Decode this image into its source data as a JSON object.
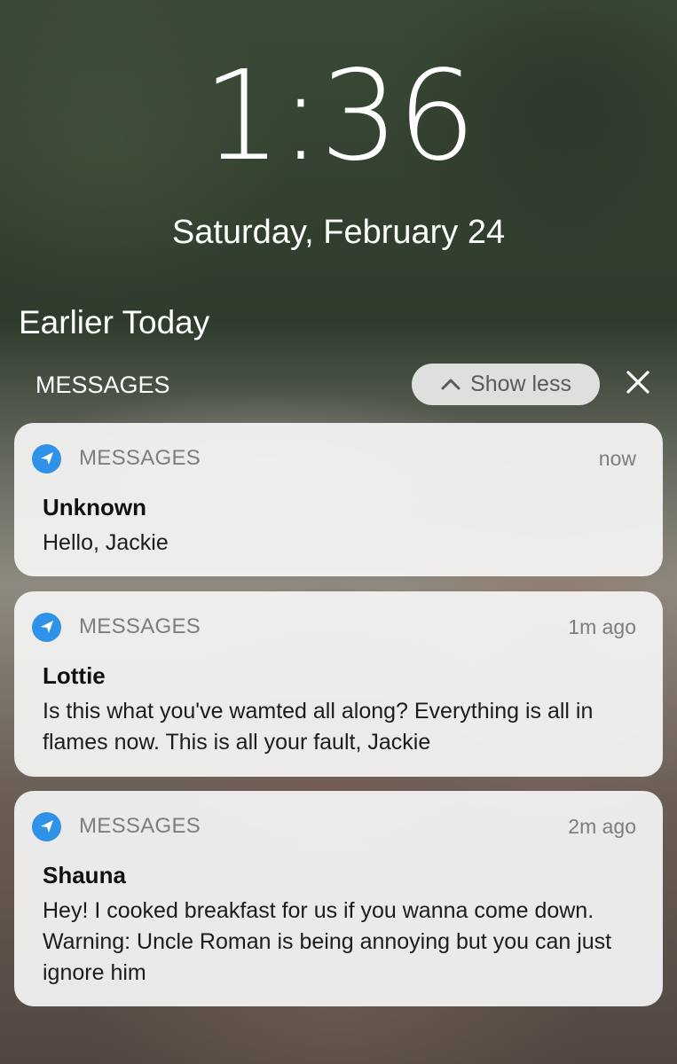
{
  "lockscreen": {
    "time": "1:36",
    "date": "Saturday, February 24"
  },
  "section": {
    "title": "Earlier Today",
    "group_label": "MESSAGES",
    "show_less_label": "Show less"
  },
  "icons": {
    "show_less": "chevron-up-icon",
    "close": "close-icon",
    "app": "send-arrow-icon"
  },
  "colors": {
    "app_icon": "#2f92e8",
    "card_background": "#f5f5f5",
    "text_primary": "#111111",
    "text_secondary": "#7d7d7d"
  },
  "notifications": [
    {
      "app": "MESSAGES",
      "time": "now",
      "sender": "Unknown",
      "message": "Hello, Jackie"
    },
    {
      "app": "MESSAGES",
      "time": "1m ago",
      "sender": "Lottie",
      "message": "Is this what you've wamted all along? Everything is all in flames now. This is all your fault, Jackie"
    },
    {
      "app": "MESSAGES",
      "time": "2m ago",
      "sender": "Shauna",
      "message": "Hey! I cooked breakfast for us if you wanna come down. Warning: Uncle Roman is being annoying but you can just ignore him"
    }
  ]
}
